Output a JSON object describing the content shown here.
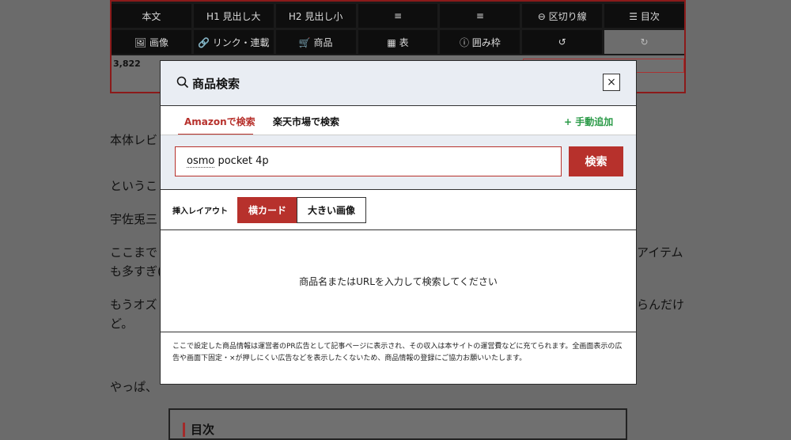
{
  "toolbar": {
    "row1": [
      "本文",
      "H1 見出し大",
      "H2 見出し小",
      "≡",
      "≡",
      "⊖ 区切り線",
      "☰ 目次"
    ],
    "row2": [
      "🖼 画像",
      "🔗 リンク・連載",
      "🛒 商品",
      "▦ 表",
      "ⓘ 囲み枠",
      "↺",
      "↻"
    ],
    "count": "3,822"
  },
  "article": {
    "line1": "本体レビ",
    "line2": "というこ",
    "line3": "宇佐兎三",
    "line4a": "ここまで",
    "line4b": "アイテム",
    "line5": "も多すぎ(",
    "line6a": "もうオズ",
    "line6b": "らんだけ",
    "line7": "ど。",
    "line8": "やっぱ、",
    "toc_title": "目次"
  },
  "modal": {
    "title": "商品検索",
    "close_label": "×",
    "tabs": {
      "amazon": "Amazonで検索",
      "rakuten": "楽天市場で検索",
      "manual_add": "+ 手動追加"
    },
    "search": {
      "value_underlined": "osmo",
      "value_rest": " pocket 4p",
      "button_label": "検索"
    },
    "layout": {
      "label": "挿入レイアウト",
      "option_card": "横カード",
      "option_large": "大きい画像"
    },
    "empty_message": "商品名またはURLを入力して検索してください",
    "disclaimer": "ここで設定した商品情報は運営者のPR広告として記事ページに表示され、その収入は本サイトの運営費などに充てられます。全画面表示の広告や画面下固定・×が押しにくい広告などを表示したくないため、商品情報の登録にご協力お願いいたします。"
  },
  "colors": {
    "accent": "#b7312c",
    "add": "#2a9a47",
    "overlay": "#6b6b6b",
    "header_bg": "#e9edf3"
  }
}
